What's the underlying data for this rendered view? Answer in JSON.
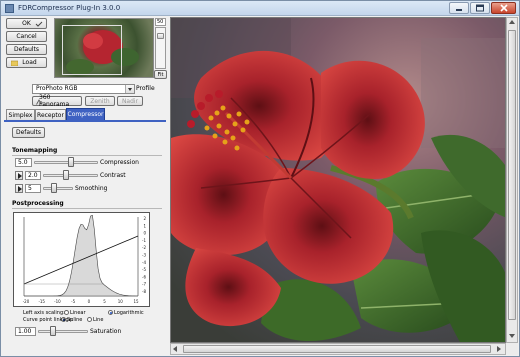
{
  "window": {
    "title": "FDRCompressor Plug-In 3.0.0"
  },
  "buttons": {
    "ok": "OK",
    "cancel": "Cancel",
    "defaults": "Defaults",
    "load": "Load"
  },
  "preview": {
    "zoom_top": "50",
    "fit": "Fit"
  },
  "profile": {
    "value": "ProPhoto RGB",
    "label": "Profile"
  },
  "panorama": {
    "label": "360 Panorama",
    "zenith": "Zenith",
    "nadir": "Nadir"
  },
  "tabs": [
    "Simplex",
    "Receptor",
    "Compressor"
  ],
  "compressor": {
    "defaults_label": "Defaults",
    "tonemapping_title": "Tonemapping",
    "compression": {
      "value": "5.0",
      "label": "Compression",
      "level": 0.58
    },
    "contrast": {
      "value": "2.0",
      "label": "Contrast",
      "level": 0.42
    },
    "smoothing": {
      "value": "5",
      "label": "Smoothing",
      "level": 0.35
    },
    "postprocessing_title": "Postprocessing",
    "left_axis_scaling": "Left axis scaling:",
    "linear": "Linear",
    "logarithmic": "Logarithmic",
    "curve_point_linkage": "Curve point linkage:",
    "spline": "Spline",
    "line": "Line",
    "saturation": {
      "value": "1.00",
      "label": "Saturation",
      "level": 0.3
    },
    "graph_x_ticks": [
      "-20",
      "-15",
      "-10",
      "-5",
      "0",
      "5",
      "10",
      "15"
    ],
    "graph_y_ticks": [
      "2",
      "1",
      "0",
      "-1",
      "-2",
      "-3",
      "-4",
      "-5",
      "-6",
      "-7",
      "-8"
    ]
  },
  "icons": {
    "app": "app-icon",
    "ok_check": "checkmark-icon",
    "load": "folder-icon",
    "panorama": "panorama-icon"
  },
  "colors": {
    "active_tab": "#3f62c2",
    "flower": "#c62a32",
    "leaf": "#3e6a2a"
  }
}
